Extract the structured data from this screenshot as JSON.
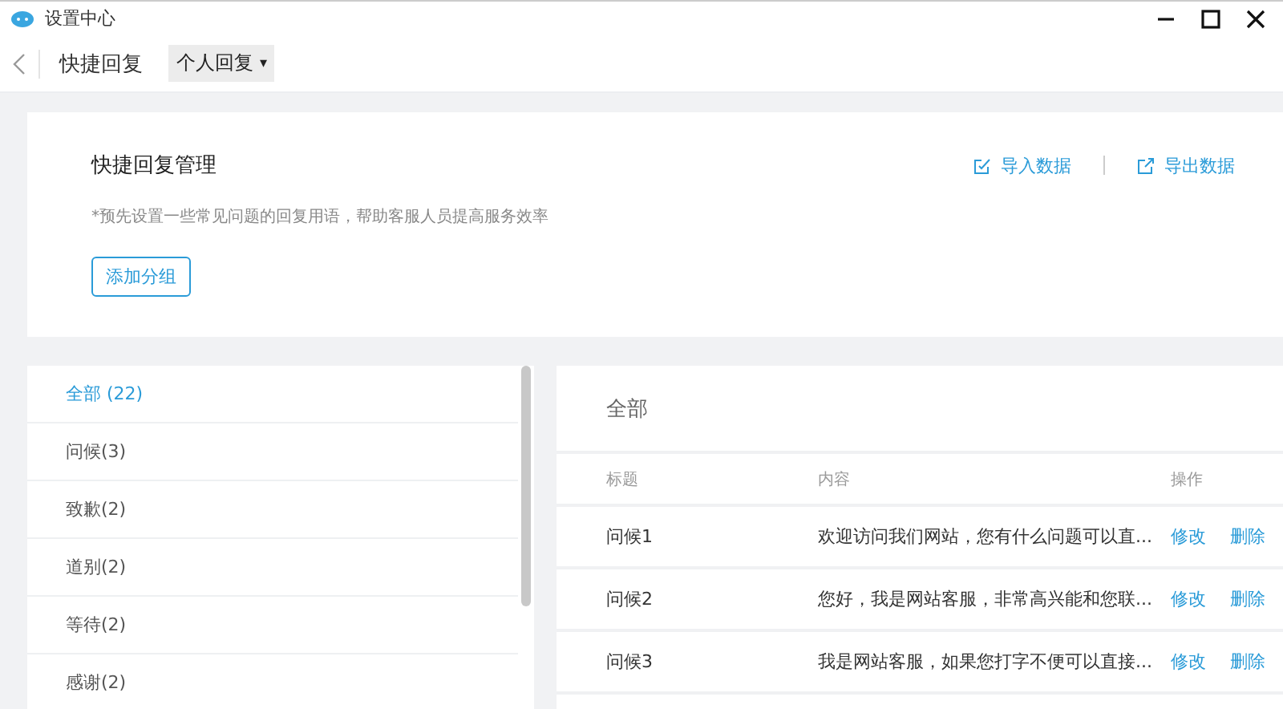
{
  "window": {
    "title": "设置中心"
  },
  "toolbar": {
    "title": "快捷回复",
    "dropdown": {
      "value": "个人回复",
      "caret": "▾"
    }
  },
  "header_card": {
    "title": "快捷回复管理",
    "description": "*预先设置一些常见问题的回复用语，帮助客服人员提高服务效率",
    "actions": [
      "导入数据",
      "导出数据"
    ],
    "add_button": "添加分组"
  },
  "groups": [
    {
      "label": "全部 (22)",
      "selected": true
    },
    {
      "label": "问候(3)",
      "selected": false
    },
    {
      "label": "致歉(2)",
      "selected": false
    },
    {
      "label": "道别(2)",
      "selected": false
    },
    {
      "label": "等待(2)",
      "selected": false
    },
    {
      "label": "感谢(2)",
      "selected": false
    }
  ],
  "table": {
    "title": "全部",
    "columns": [
      "标题",
      "内容",
      "操作"
    ],
    "rows": [
      {
        "title": "问候1",
        "content": "欢迎访问我们网站，您有什么问题可以直...",
        "actions": [
          "修改",
          "删除"
        ]
      },
      {
        "title": "问候2",
        "content": "您好，我是网站客服，非常高兴能和您联...",
        "actions": [
          "修改",
          "删除"
        ]
      },
      {
        "title": "问候3",
        "content": "我是网站客服，如果您打字不便可以直接...",
        "actions": [
          "修改",
          "删除"
        ]
      }
    ]
  }
}
